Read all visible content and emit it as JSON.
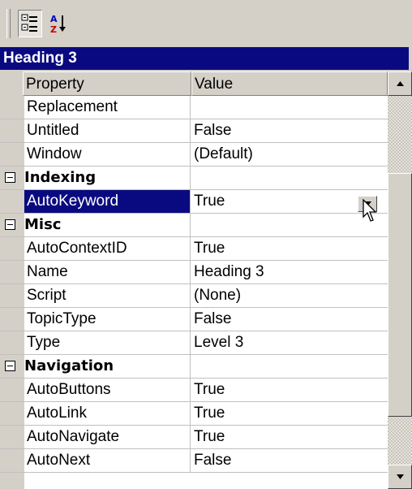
{
  "toolbar": {
    "categorized_icon": "categorized-view-icon",
    "alphabetic_icon": "alphabetic-sort-icon"
  },
  "selection_title": "Heading 3",
  "columns": {
    "property": "Property",
    "value": "Value"
  },
  "rows": [
    {
      "type": "prop",
      "name": "Replacement",
      "value": ""
    },
    {
      "type": "prop",
      "name": "Untitled",
      "value": "False"
    },
    {
      "type": "prop",
      "name": "Window",
      "value": "(Default)"
    },
    {
      "type": "category",
      "name": "Indexing"
    },
    {
      "type": "prop",
      "name": "AutoKeyword",
      "value": "True",
      "selected": true
    },
    {
      "type": "category",
      "name": "Misc"
    },
    {
      "type": "prop",
      "name": "AutoContextID",
      "value": "True"
    },
    {
      "type": "prop",
      "name": "Name",
      "value": "Heading 3"
    },
    {
      "type": "prop",
      "name": "Script",
      "value": "(None)"
    },
    {
      "type": "prop",
      "name": "TopicType",
      "value": "False"
    },
    {
      "type": "prop",
      "name": "Type",
      "value": "Level 3"
    },
    {
      "type": "category",
      "name": "Navigation"
    },
    {
      "type": "prop",
      "name": "AutoButtons",
      "value": "True"
    },
    {
      "type": "prop",
      "name": "AutoLink",
      "value": "True"
    },
    {
      "type": "prop",
      "name": "AutoNavigate",
      "value": "True"
    },
    {
      "type": "prop",
      "name": "AutoNext",
      "value": "False"
    }
  ],
  "scrollbar": {
    "thumb_start": 0.21,
    "thumb_end": 0.87
  },
  "colors": {
    "title_bar": "#0a0a80",
    "selection": "#0a0a80",
    "face": "#d4d0c8"
  }
}
